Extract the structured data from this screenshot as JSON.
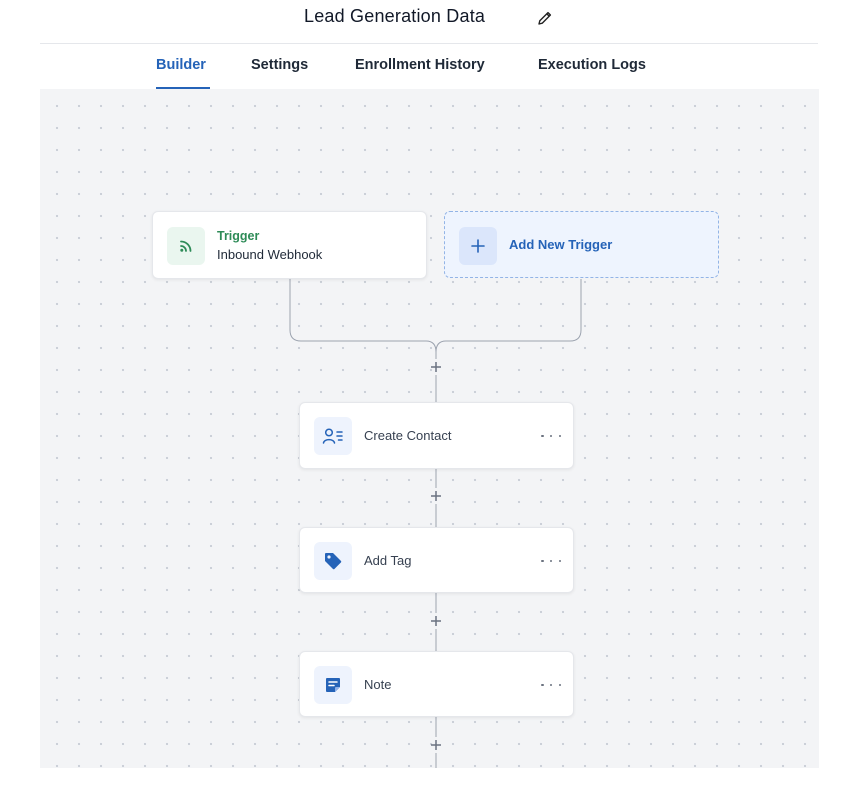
{
  "header": {
    "title": "Lead Generation Data"
  },
  "tabs": [
    {
      "label": "Builder",
      "active": true
    },
    {
      "label": "Settings",
      "active": false
    },
    {
      "label": "Enrollment History",
      "active": false
    },
    {
      "label": "Execution Logs",
      "active": false
    }
  ],
  "trigger": {
    "heading": "Trigger",
    "name": "Inbound Webhook"
  },
  "add_trigger": {
    "label": "Add New Trigger"
  },
  "actions": [
    {
      "label": "Create Contact",
      "icon": "contact-icon"
    },
    {
      "label": "Add Tag",
      "icon": "tag-icon"
    },
    {
      "label": "Note",
      "icon": "note-icon"
    }
  ],
  "colors": {
    "accent": "#2563b8",
    "trigger_green": "#2e8b57",
    "canvas": "#f3f4f6"
  }
}
